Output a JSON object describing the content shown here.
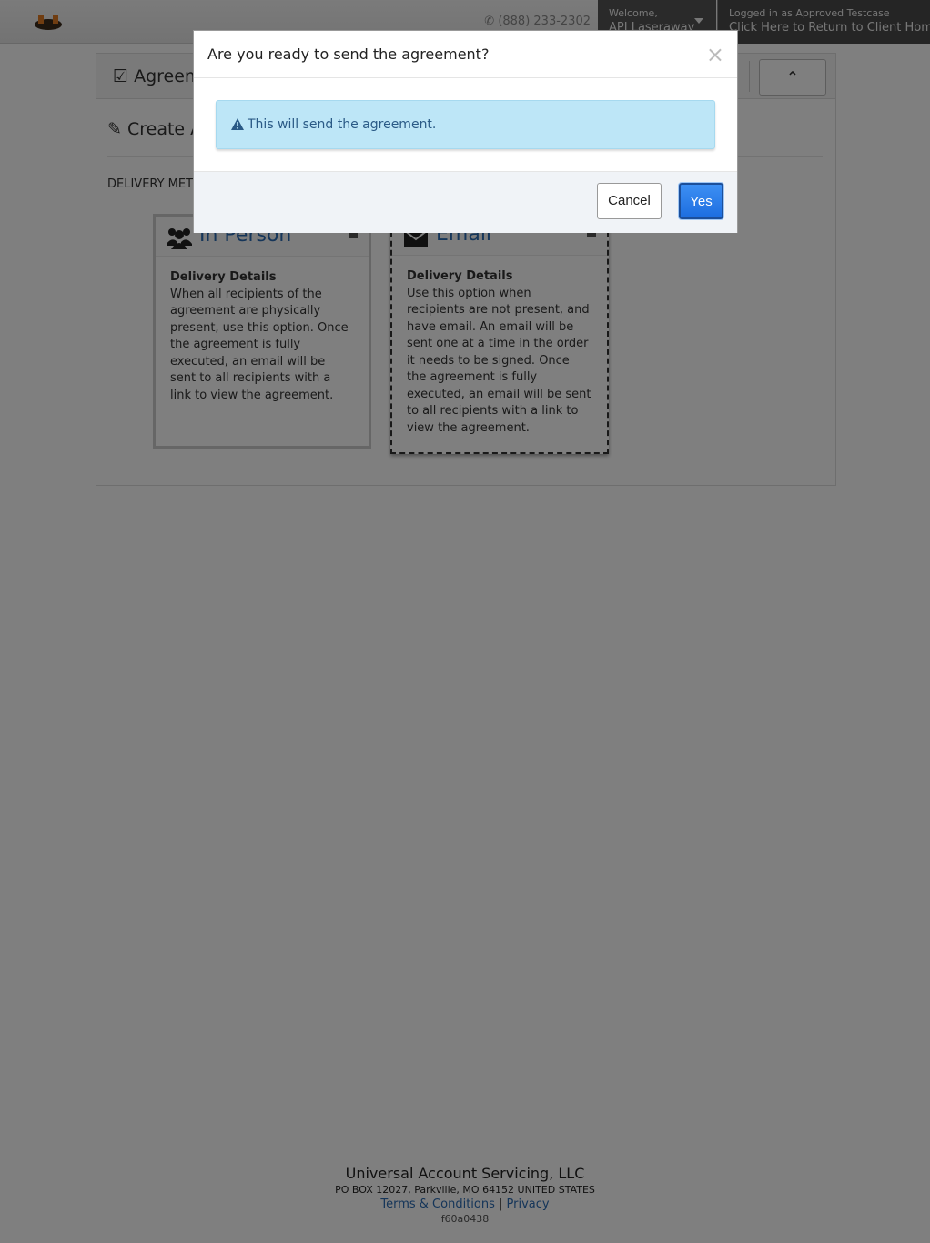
{
  "topnav": {
    "phone": "(888) 233-2302",
    "welcome_label": "Welcome,",
    "welcome_name": "API Laseraway",
    "logged_in_label": "Logged in as Approved Testcase",
    "return_link": "Click Here to Return to Client Home"
  },
  "panel": {
    "title": "Agreements",
    "section_title": "Create Agreement",
    "delivery_label": "DELIVERY METHOD"
  },
  "cards": [
    {
      "title": "In Person",
      "details_label": "Delivery Details",
      "details": "When all recipients of the agreement are physically present, use this option. Once the agreement is fully executed, an email will be sent to all recipients with a link to view the agreement."
    },
    {
      "title": "Email",
      "details_label": "Delivery Details",
      "details": "Use this option when recipients are not present, and have email. An email will be sent one at a time in the order it needs to be signed. Once the agreement is fully executed, an email will be sent to all recipients with a link to view the agreement."
    }
  ],
  "modal": {
    "title": "Are you ready to send the agreement?",
    "close_glyph": "×",
    "alert_text": "This will send the agreement.",
    "cancel_label": "Cancel",
    "yes_label": "Yes"
  },
  "footer": {
    "company": "Universal Account Servicing, LLC",
    "address": "PO BOX 12027, Parkville, MO 64152 UNITED STATES",
    "terms_link": "Terms & Conditions",
    "separator": "|",
    "privacy_link": "Privacy",
    "hash": "f60a0438"
  },
  "colors": {
    "link_blue": "#2a6bb3",
    "alert_bg": "#bde6f7",
    "yes_button": "#1d6ee0"
  }
}
